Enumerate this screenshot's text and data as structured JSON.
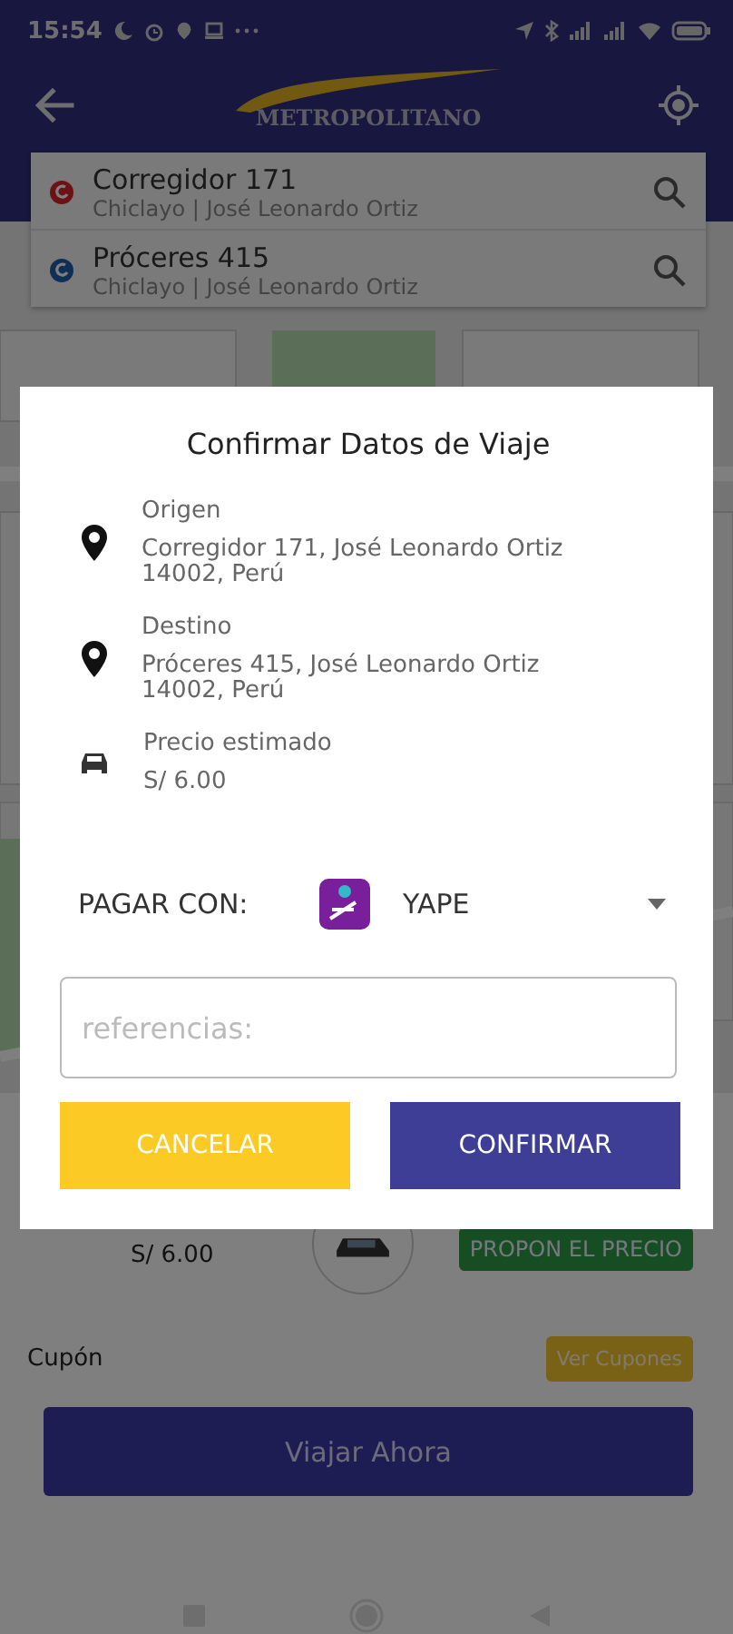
{
  "status_bar": {
    "time": "15:54"
  },
  "header": {
    "logo_text": "METROPOLITANO"
  },
  "route": [
    {
      "kind": "origin",
      "title": "Corregidor 171",
      "subtitle": "Chiclayo | José Leonardo Ortiz"
    },
    {
      "kind": "destination",
      "title": "Próceres 415",
      "subtitle": "Chiclayo | José Leonardo Ortiz"
    }
  ],
  "trip_panel": {
    "price": "S/ 6.00",
    "propose_button": "PROPON EL PRECIO",
    "coupon_label": "Cupón",
    "coupon_button": "Ver Cupones",
    "travel_button": "Viajar Ahora"
  },
  "dialog": {
    "title": "Confirmar Datos de Viaje",
    "details": [
      {
        "kind": "place",
        "label": "Origen",
        "value": "Corregidor 171, José Leonardo Ortiz 14002, Perú"
      },
      {
        "kind": "place",
        "label": "Destino",
        "value": "Próceres 415, José Leonardo Ortiz 14002, Perú"
      },
      {
        "kind": "price",
        "label": "Precio estimado",
        "value": "S/ 6.00"
      }
    ],
    "payment": {
      "label": "PAGAR CON:",
      "method": "YAPE"
    },
    "references": {
      "placeholder": "referencias:"
    },
    "buttons": [
      {
        "kind": "cancel",
        "label": "CANCELAR"
      },
      {
        "kind": "confirm",
        "label": "CONFIRMAR"
      }
    ]
  }
}
